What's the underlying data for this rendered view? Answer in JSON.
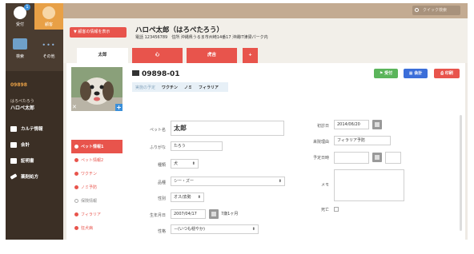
{
  "nav": {
    "tiles": [
      {
        "label": "受付",
        "badge": "1"
      },
      {
        "label": "顧客"
      },
      {
        "label": "検索"
      },
      {
        "label": "その他"
      }
    ],
    "patient_id": "09898",
    "patient_kana": "はろぺたろう",
    "patient_name": "ハロペ太郎",
    "menu": [
      "カルテ情報",
      "会計",
      "証明書",
      "薬剤処方"
    ]
  },
  "search": {
    "placeholder": "クイック検索"
  },
  "header": {
    "customer_button": "▼ 顧客の情報を表示",
    "name": "ハロペ太郎（はろぺたろう）",
    "info": "電話 123456789　住所 沖縄県うるま市州崎14番17 沖縄IT津梁パーク内",
    "tabs": [
      "太郎",
      "心",
      "虎吉",
      "+"
    ]
  },
  "pet": {
    "id": "09898-01",
    "plan_label": "実施の予定",
    "plans": [
      "ワクチン",
      "ノミ",
      "フィラリア"
    ],
    "actions": {
      "reception": "受付",
      "accounting": "会計",
      "print": "印刷"
    },
    "sub_menu": [
      {
        "label": "ペット情報1",
        "state": "active"
      },
      {
        "label": "ペット情報2",
        "state": "normal"
      },
      {
        "label": "ワクチン",
        "state": "normal"
      },
      {
        "label": "ノミ予防",
        "state": "normal"
      },
      {
        "label": "保険情報",
        "state": "muted"
      },
      {
        "label": "フィラリア",
        "state": "normal"
      },
      {
        "label": "狂犬病",
        "state": "normal"
      }
    ],
    "fields": {
      "pet_name_label": "ペット名",
      "pet_name": "太郎",
      "kana_label": "ふりがな",
      "kana": "たろう",
      "species_label": "種類",
      "species": "犬",
      "breed_label": "品種",
      "breed": "シー・ズー",
      "sex_label": "性別",
      "sex": "オス/去勢",
      "birth_label": "生年月日",
      "birth": "2007/04/17",
      "age": "7歳1ヶ月",
      "temper_label": "性格",
      "temper": "－(いつも穏やか)",
      "first_visit_label": "初診日",
      "first_visit": "2014/06/20",
      "reason_label": "来院理由",
      "reason": "フィラリア予防",
      "appointment_label": "予定日時",
      "memo_label": "メモ",
      "deceased_label": "死亡"
    }
  }
}
